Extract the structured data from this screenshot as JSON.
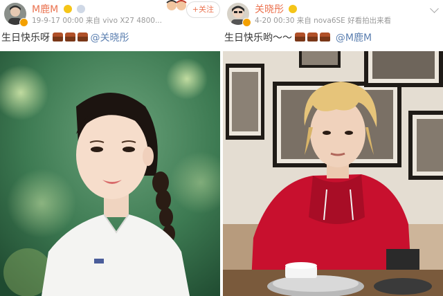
{
  "left_post": {
    "username": "M鹿M",
    "meta": "19-9-17 00:00   来自 vivo X27 4800...",
    "text": "生日快乐呀",
    "mention": "@关晓彤",
    "follow_label": "+关注",
    "photo_subject": "portrait-girl-white-top-braid"
  },
  "right_post": {
    "username": "关晓彤",
    "meta": "4-20 00:30   来自 nova6SE 好看拍出来看",
    "text": "生日快乐哟～～",
    "mention": "@M鹿M",
    "photo_subject": "young-man-red-hoodie-restaurant"
  },
  "colors": {
    "username": "#eb7350",
    "mention": "#5b7fb0",
    "meta": "#999999",
    "hoodie": "#c8102e"
  }
}
